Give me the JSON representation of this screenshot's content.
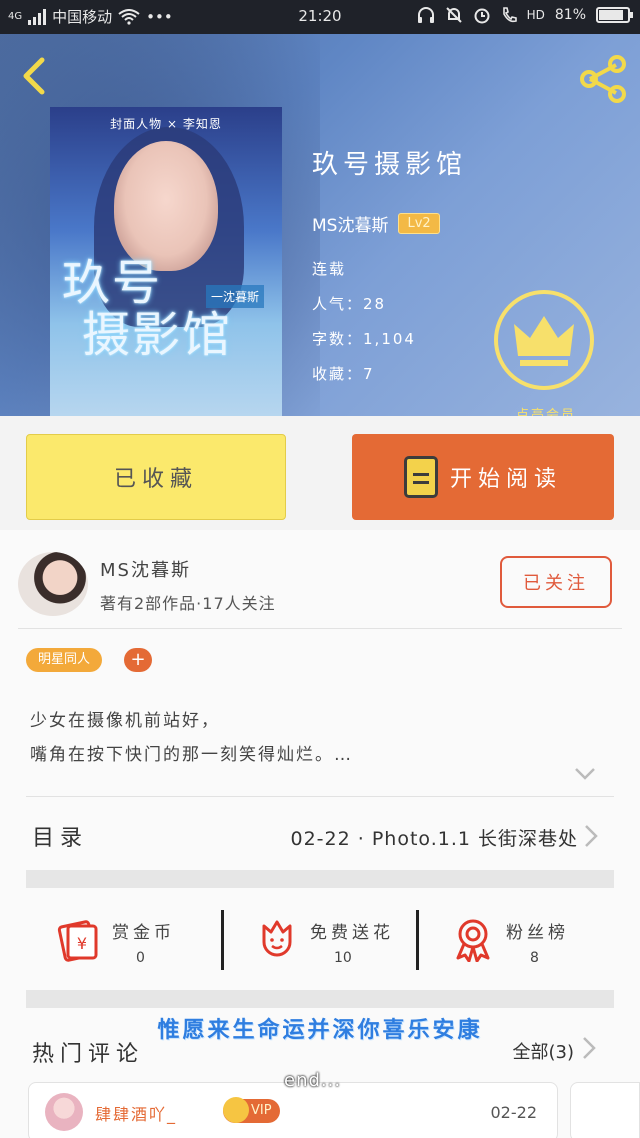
{
  "status_bar": {
    "network": "4G",
    "carrier": "中国移动",
    "extra": "•••",
    "time": "21:20",
    "hd": "HD",
    "battery": "81%"
  },
  "book": {
    "cover_caption": "封面人物 × 李知恩",
    "cover_title_line1": "玖号",
    "cover_title_line2": "摄影馆",
    "cover_sub": "一沈暮斯",
    "title": "玖号摄影馆",
    "author": "MS沈暮斯",
    "level": "Lv2",
    "status": "连载",
    "popularity_label": "人气：",
    "popularity": "28",
    "words_label": "字数：",
    "words": "1,104",
    "favorites_label": "收藏：",
    "favorites": "7"
  },
  "vip_badge": {
    "label": "点亮会员",
    "icon": "crown-icon"
  },
  "actions": {
    "favorited_label": "已收藏",
    "read_label": "开始阅读",
    "read_icon": "book-icon"
  },
  "author_card": {
    "name": "MS沈暮斯",
    "sub": "著有2部作品·17人关注",
    "follow_label": "已关注"
  },
  "tags": [
    {
      "label": "明星同人"
    }
  ],
  "tag_add": "+",
  "intro": {
    "line1": "少女在摄像机前站好，",
    "line2": "嘴角在按下快门的那一刻笑得灿烂。…"
  },
  "toc": {
    "label": "目录",
    "latest": "02-22 · Photo.1.1 长街深巷处"
  },
  "stats": [
    {
      "label": "赏金币",
      "value": "0",
      "icon": "red-envelope-icon"
    },
    {
      "label": "免费送花",
      "value": "10",
      "icon": "flower-icon"
    },
    {
      "label": "粉丝榜",
      "value": "8",
      "icon": "ribbon-medal-icon"
    }
  ],
  "hot_comments": {
    "label": "热门评论",
    "all_label": "全部(3)"
  },
  "overlay_caption": "惟愿来生命运并深你喜乐安康",
  "end_caption": "end...",
  "comment": {
    "name": "肆肆酒吖_",
    "vip": "VIP",
    "date": "02-22"
  },
  "colors": {
    "accent": "#e46a35",
    "favorite_button": "#fbe96c",
    "vip_gold": "#f7e06b",
    "tag": "#f3a93a"
  }
}
